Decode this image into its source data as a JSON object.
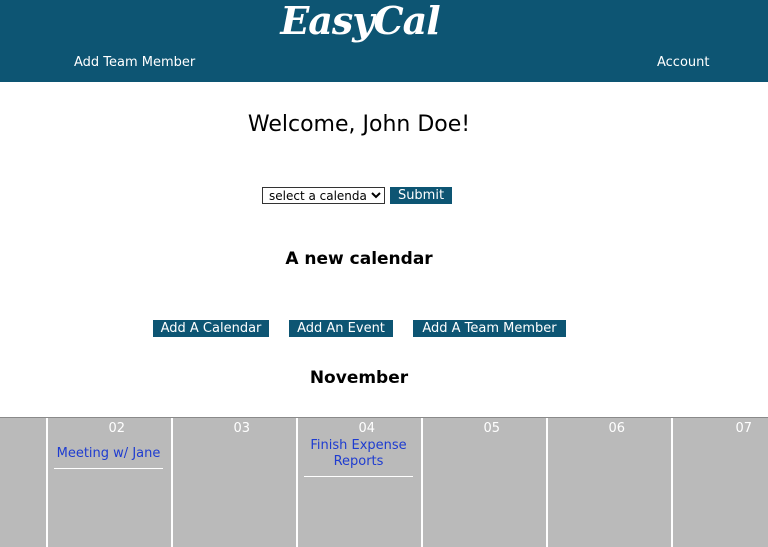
{
  "header": {
    "logo": "EasyCal",
    "nav": {
      "add_team_member": "Add Team Member",
      "account": "Account"
    },
    "bg_color": "#0d5573"
  },
  "main": {
    "welcome": "Welcome, John Doe!",
    "calendar_select": {
      "selected": "select a calendar"
    },
    "submit_label": "Submit",
    "new_calendar_title": "A new calendar",
    "actions": {
      "add_calendar": "Add A Calendar",
      "add_event": "Add An Event",
      "add_team_member": "Add A Team Member"
    },
    "month": "November"
  },
  "calendar": {
    "days": [
      {
        "num": "",
        "events": []
      },
      {
        "num": "02",
        "events": [
          "Meeting w/ Jane"
        ]
      },
      {
        "num": "03",
        "events": []
      },
      {
        "num": "04",
        "events": [
          "Finish Expense Reports"
        ]
      },
      {
        "num": "05",
        "events": []
      },
      {
        "num": "06",
        "events": []
      },
      {
        "num": "07",
        "events": []
      }
    ],
    "cell_color": "#bababa",
    "event_color": "#1e3cd0"
  }
}
